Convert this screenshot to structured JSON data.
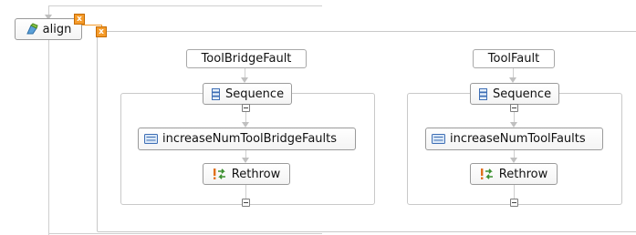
{
  "scope": {
    "label": "align",
    "fault_badge": "x",
    "handler_badge": "x",
    "icon": "scope-icon"
  },
  "handlers": [
    {
      "fault_name": "ToolBridgeFault",
      "sequence_label": "Sequence",
      "assign_label": "increaseNumToolBridgeFaults",
      "rethrow_label": "Rethrow"
    },
    {
      "fault_name": "ToolFault",
      "sequence_label": "Sequence",
      "assign_label": "increaseNumToolFaults",
      "rethrow_label": "Rethrow"
    }
  ],
  "colors": {
    "connector": "#cfcfcf",
    "badge": "#f59b2a",
    "border": "#9a9a9a"
  }
}
